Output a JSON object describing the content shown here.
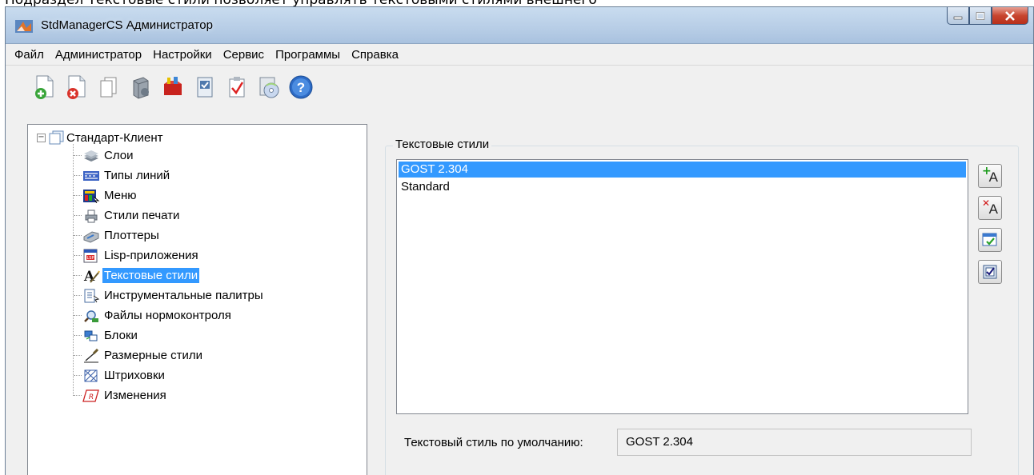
{
  "doc_caption": "Подраздел Текстовые стили позволяет управлять текстовыми стилями внешнего",
  "window": {
    "title": "StdManagerCS Администратор"
  },
  "menu": [
    "Файл",
    "Администратор",
    "Настройки",
    "Сервис",
    "Программы",
    "Справка"
  ],
  "toolbar": {
    "icons": [
      "new-doc-icon",
      "delete-doc-icon",
      "copy-icon",
      "server-icon",
      "toolbox-icon",
      "check-doc-icon",
      "checklist-icon",
      "cd-icon",
      "help-icon"
    ]
  },
  "tree": {
    "root": "Стандарт-Клиент",
    "items": [
      "Слои",
      "Типы линий",
      "Меню",
      "Стили печати",
      "Плоттеры",
      "Lisp-приложения",
      "Текстовые стили",
      "Инструментальные палитры",
      "Файлы нормоконтроля",
      "Блоки",
      "Размерные стили",
      "Штриховки",
      "Изменения"
    ],
    "selected": "Текстовые стили"
  },
  "panel": {
    "title": "Текстовые стили",
    "list": [
      "GOST 2.304",
      "Standard"
    ],
    "selected": "GOST 2.304",
    "default_label": "Текстовый стиль по умолчанию:",
    "default_value": "GOST 2.304"
  },
  "side_buttons": {
    "add_letter": "A",
    "delete_letter": "A"
  },
  "colors": {
    "selection": "#3399ff",
    "titlebar": "#b7cde6",
    "close": "#c8452f"
  }
}
